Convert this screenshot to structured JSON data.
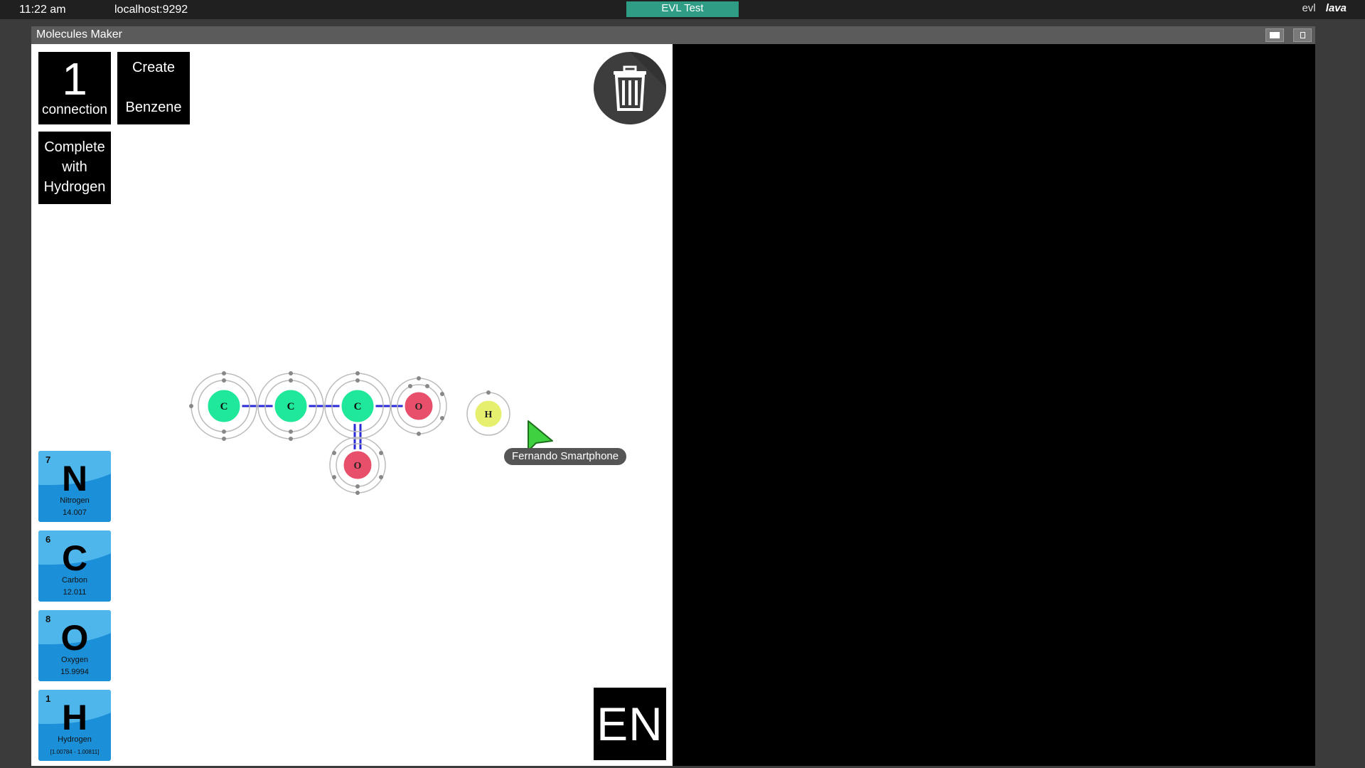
{
  "system_bar": {
    "time": "11:22 am",
    "host": "localhost:9292",
    "session_name": "EVL Test",
    "brand_evl": "evl",
    "brand_lava": "lava"
  },
  "window": {
    "title": "Molecules Maker"
  },
  "controls": {
    "connections_count": "1",
    "connections_label": "connection",
    "create_line1": "Create",
    "create_line2": "Benzene",
    "complete_line1": "Complete",
    "complete_line2": "with",
    "complete_line3": "Hydrogen",
    "language": "EN"
  },
  "elements": [
    {
      "number": "7",
      "symbol": "N",
      "name": "Nitrogen",
      "mass": "14.007"
    },
    {
      "number": "6",
      "symbol": "C",
      "name": "Carbon",
      "mass": "12.011"
    },
    {
      "number": "8",
      "symbol": "O",
      "name": "Oxygen",
      "mass": "15.9994"
    },
    {
      "number": "1",
      "symbol": "H",
      "name": "Hydrogen",
      "mass": "[1.00784 - 1.00811]"
    }
  ],
  "molecule_atoms": [
    {
      "symbol": "C",
      "color": "#1fe89a"
    },
    {
      "symbol": "C",
      "color": "#1fe89a"
    },
    {
      "symbol": "C",
      "color": "#1fe89a"
    },
    {
      "symbol": "O",
      "color": "#e84f6a"
    },
    {
      "symbol": "O",
      "color": "#e84f6a"
    },
    {
      "symbol": "H",
      "color": "#e6f06e"
    }
  ],
  "cursor": {
    "user": "Fernando Smartphone",
    "color": "#3fd13f"
  },
  "colors": {
    "bond": "#2b2bd6",
    "tile_blue": "#1b8fd8",
    "session_badge": "#2f9c86"
  }
}
